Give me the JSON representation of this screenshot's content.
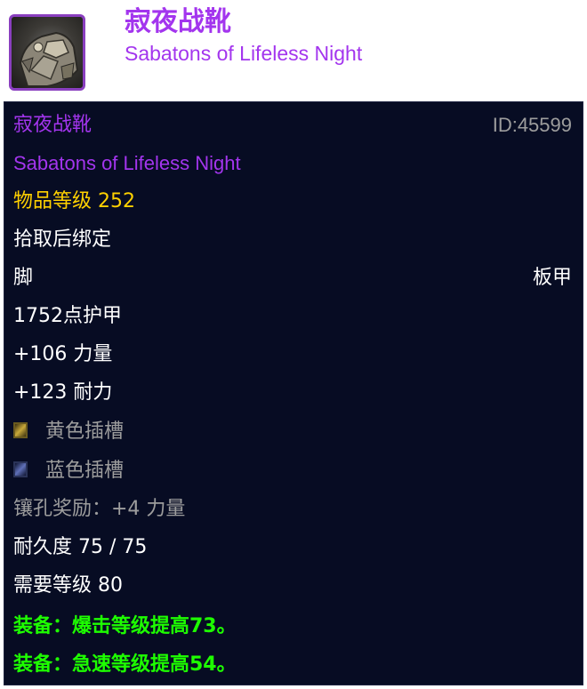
{
  "header": {
    "icon": "sabatons-boots-icon",
    "title_cn": "寂夜战靴",
    "title_en": "Sabatons of Lifeless Night"
  },
  "tooltip": {
    "name_cn": "寂夜战靴",
    "item_id": "ID:45599",
    "name_en": "Sabatons of Lifeless Night",
    "item_level": "物品等级 252",
    "binding": "拾取后绑定",
    "slot": "脚",
    "armor_type": "板甲",
    "armor": "1752点护甲",
    "stat_strength": "+106 力量",
    "stat_stamina": "+123 耐力",
    "sockets": [
      {
        "icon": "yellow-socket-icon",
        "label": "黄色插槽",
        "color": "#c8a83a"
      },
      {
        "icon": "blue-socket-icon",
        "label": "蓝色插槽",
        "color": "#5f70b8"
      }
    ],
    "socket_bonus": "镶孔奖励：+4 力量",
    "durability": "耐久度 75 / 75",
    "required_level": "需要等级 80",
    "equip_effects": [
      "装备：爆击等级提高73。",
      "装备：急速等级提高54。"
    ]
  },
  "colors": {
    "epic": "#a335ee",
    "item_level": "#ffd100",
    "muted": "#9d9d9d",
    "equip": "#1eff00",
    "background": "#070c23"
  }
}
